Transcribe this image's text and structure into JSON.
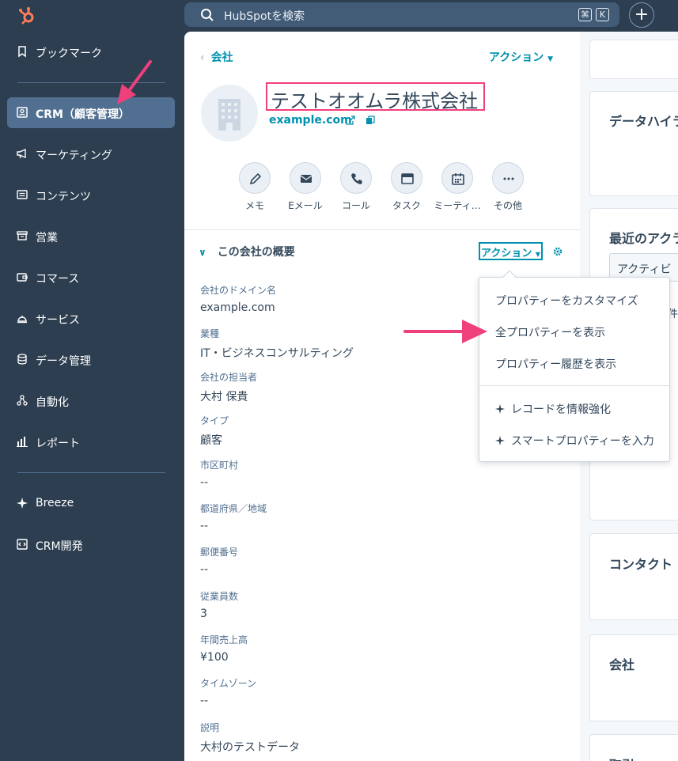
{
  "topbar": {
    "search_placeholder": "HubSpotを検索",
    "kbd1": "⌘",
    "kbd2": "K",
    "plus": "+"
  },
  "sidebar": {
    "items": [
      {
        "label": "ブックマーク",
        "icon": "bookmark-icon"
      },
      {
        "label": "CRM（顧客管理）",
        "icon": "contact-card-icon",
        "active": true
      },
      {
        "label": "マーケティング",
        "icon": "megaphone-icon"
      },
      {
        "label": "コンテンツ",
        "icon": "content-icon"
      },
      {
        "label": "営業",
        "icon": "sales-icon"
      },
      {
        "label": "コマース",
        "icon": "commerce-icon"
      },
      {
        "label": "サービス",
        "icon": "service-icon"
      },
      {
        "label": "データ管理",
        "icon": "database-icon"
      },
      {
        "label": "自動化",
        "icon": "automation-icon"
      },
      {
        "label": "レポート",
        "icon": "report-icon"
      },
      {
        "label": "Breeze",
        "icon": "sparkle-icon"
      },
      {
        "label": "CRM開発",
        "icon": "developer-icon"
      }
    ]
  },
  "record": {
    "back_label": "会社",
    "action_label": "アクション",
    "company_name": "テストオオムラ株式会社",
    "domain": "example.com"
  },
  "quick_actions": [
    {
      "label": "メモ",
      "icon": "note-icon"
    },
    {
      "label": "Eメール",
      "icon": "email-icon"
    },
    {
      "label": "コール",
      "icon": "phone-icon"
    },
    {
      "label": "タスク",
      "icon": "task-icon"
    },
    {
      "label": "ミーティ…",
      "icon": "calendar-icon"
    },
    {
      "label": "その他",
      "icon": "more-icon"
    }
  ],
  "about": {
    "title": "この会社の概要",
    "action_label": "アクション",
    "properties": [
      {
        "label": "会社のドメイン名",
        "value": "example.com"
      },
      {
        "label": "業種",
        "value": "IT・ビジネスコンサルティング"
      },
      {
        "label": "会社の担当者",
        "value": "大村 保貴"
      },
      {
        "label": "タイプ",
        "value": "顧客"
      },
      {
        "label": "市区町村",
        "value": "--"
      },
      {
        "label": "都道府県／地域",
        "value": "--"
      },
      {
        "label": "郵便番号",
        "value": "--"
      },
      {
        "label": "従業員数",
        "value": "3"
      },
      {
        "label": "年間売上高",
        "value": "¥100"
      },
      {
        "label": "タイムゾーン",
        "value": "--"
      },
      {
        "label": "説明",
        "value": "大村のテストデータ"
      }
    ]
  },
  "dropdown": {
    "items": [
      "プロパティーをカスタマイズ",
      "全プロパティーを表示",
      "プロパティー履歴を表示"
    ],
    "ai_items": [
      "レコードを情報強化",
      "スマートプロパティーを入力"
    ]
  },
  "right_cards": [
    {
      "title": ""
    },
    {
      "title": "データハイラ"
    },
    {
      "title": "最近のアクラ",
      "input_text": "アクティビ",
      "side_text": "件"
    },
    {
      "title": ""
    },
    {
      "title": "コンタクト"
    },
    {
      "title": "会社"
    },
    {
      "title": "取引"
    }
  ],
  "colors": {
    "sidebar_bg": "#2d3e50",
    "accent": "#0091ae",
    "highlight": "#f0407c",
    "text": "#33475b"
  }
}
